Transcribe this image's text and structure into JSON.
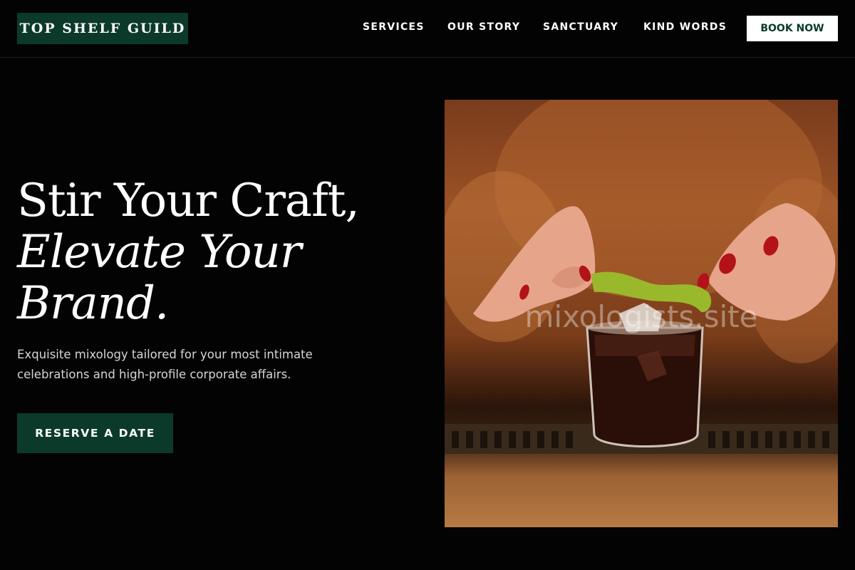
{
  "brand": {
    "name": "TOP SHELF GUILD"
  },
  "nav": {
    "links": [
      "SERVICES",
      "OUR STORY",
      "SANCTUARY",
      "KIND WORDS"
    ],
    "cta": "BOOK NOW"
  },
  "hero": {
    "headline_line1": "Stir Your Craft,",
    "headline_line2": "Elevate Your",
    "headline_line3": "Brand.",
    "subtext": "Exquisite mixology tailored for your most intimate celebrations and high-profile corporate affairs.",
    "cta": "RESERVE A DATE"
  },
  "photo": {
    "subject": "bartender-garnishing-cocktail",
    "watermark": "mixologists.site"
  },
  "colors": {
    "background": "#030303",
    "brand_green": "#0b3a2a",
    "text": "#ffffff",
    "subtext": "#d6d6d6"
  }
}
